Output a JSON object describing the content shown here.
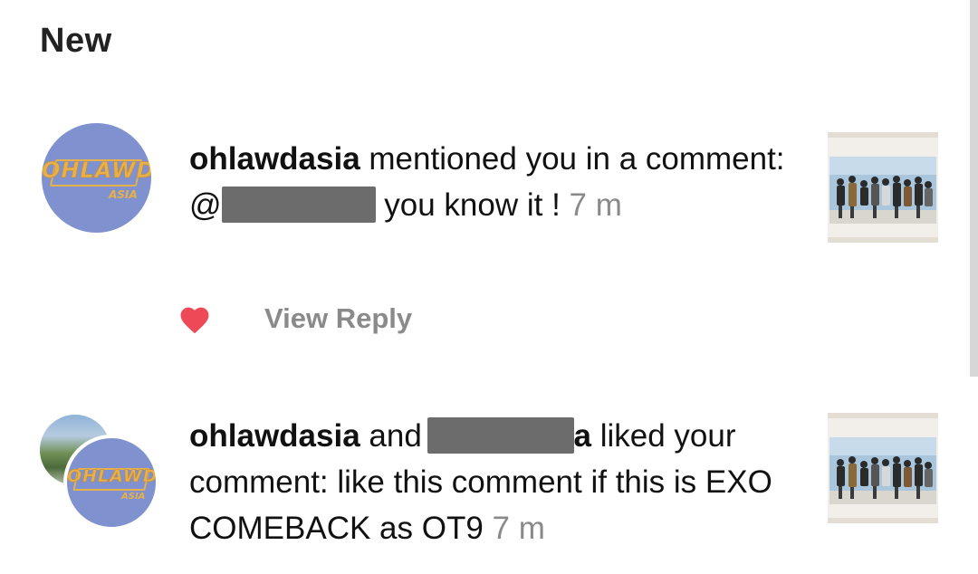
{
  "header": {
    "section_title": "New"
  },
  "notifications": [
    {
      "username": "ohlawdasia",
      "text_before": " mentioned you in a comment: @",
      "text_after": " you know it ! ",
      "timestamp": "7 m",
      "action": "View Reply"
    },
    {
      "username": "ohlawdasia",
      "connector": " and ",
      "text_prefix": "a",
      "text_after": " liked your comment: like this comment if this is EXO COMEBACK as OT9 ",
      "timestamp": "7 m"
    }
  ],
  "avatar": {
    "logo_text": "OHLAWD",
    "logo_sub": "ASIA"
  },
  "colors": {
    "avatar_bg": "#7f92cf",
    "logo": "#e6b04a",
    "heart": "#ed4956",
    "muted_text": "#8a8a8a",
    "redaction": "#6c6c6c"
  }
}
